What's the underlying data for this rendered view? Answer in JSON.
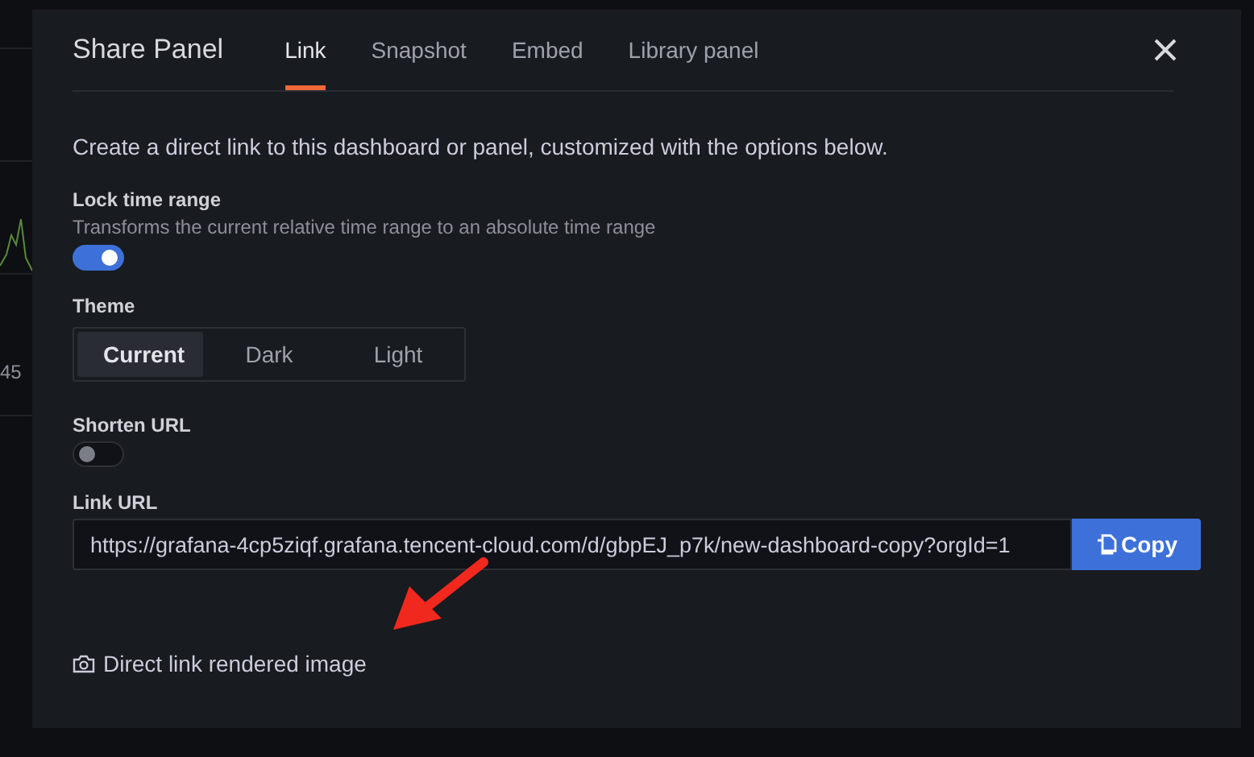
{
  "background": {
    "axis_label": "45"
  },
  "modal": {
    "title": "Share Panel",
    "tabs": [
      {
        "label": "Link",
        "selected": true
      },
      {
        "label": "Snapshot",
        "selected": false
      },
      {
        "label": "Embed",
        "selected": false
      },
      {
        "label": "Library panel",
        "selected": false
      }
    ],
    "description": "Create a direct link to this dashboard or panel, customized with the options below.",
    "lock_time_range": {
      "label": "Lock time range",
      "hint": "Transforms the current relative time range to an absolute time range",
      "on": true
    },
    "theme": {
      "label": "Theme",
      "options": [
        {
          "label": "Current",
          "selected": true
        },
        {
          "label": "Dark",
          "selected": false
        },
        {
          "label": "Light",
          "selected": false
        }
      ]
    },
    "shorten_url": {
      "label": "Shorten URL",
      "on": false
    },
    "link_url": {
      "label": "Link URL",
      "value": "https://grafana-4cp5ziqf.grafana.tencent-cloud.com/d/gbpEJ_p7k/new-dashboard-copy?orgId=1",
      "button": "Copy"
    },
    "rendered_image_link": "Direct link rendered image"
  }
}
